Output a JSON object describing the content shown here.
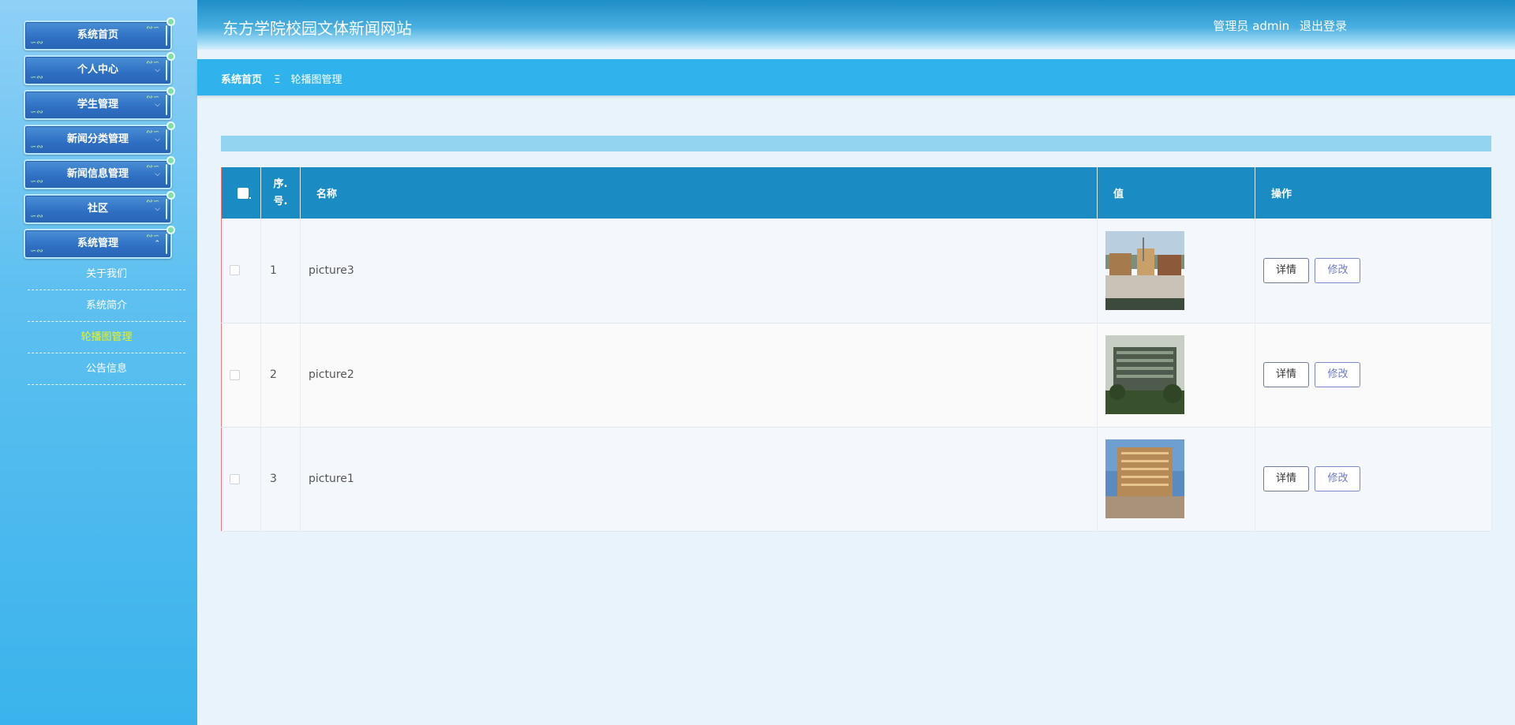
{
  "app": {
    "title": "东方学院校园文体新闻网站",
    "user_label": "管理员 admin",
    "logout_label": "退出登录"
  },
  "sidebar": {
    "menus": [
      {
        "label": "系统首页"
      },
      {
        "label": "个人中心"
      },
      {
        "label": "学生管理"
      },
      {
        "label": "新闻分类管理"
      },
      {
        "label": "新闻信息管理"
      },
      {
        "label": "社区"
      },
      {
        "label": "系统管理"
      }
    ],
    "submenu": [
      {
        "label": "关于我们",
        "active": false
      },
      {
        "label": "系统简介",
        "active": false
      },
      {
        "label": "轮播图管理",
        "active": true
      },
      {
        "label": "公告信息",
        "active": false
      }
    ]
  },
  "breadcrumb": {
    "home": "系统首页",
    "separator": "Ξ",
    "current": "轮播图管理"
  },
  "table": {
    "headers": {
      "index": "序.号.",
      "name": "名称",
      "value": "值",
      "actions": "操作"
    },
    "rows": [
      {
        "index": "1",
        "name": "picture3",
        "image": "campus-plaza-photo"
      },
      {
        "index": "2",
        "name": "picture2",
        "image": "green-building-photo"
      },
      {
        "index": "3",
        "name": "picture1",
        "image": "library-building-photo"
      }
    ],
    "detail_label": "详情",
    "edit_label": "修改"
  },
  "colors": {
    "header_blue": "#1b8cc3",
    "breadcrumb_blue": "#30b3ec",
    "active_menu": "#ecf312",
    "edit_button": "#6d78c8"
  }
}
